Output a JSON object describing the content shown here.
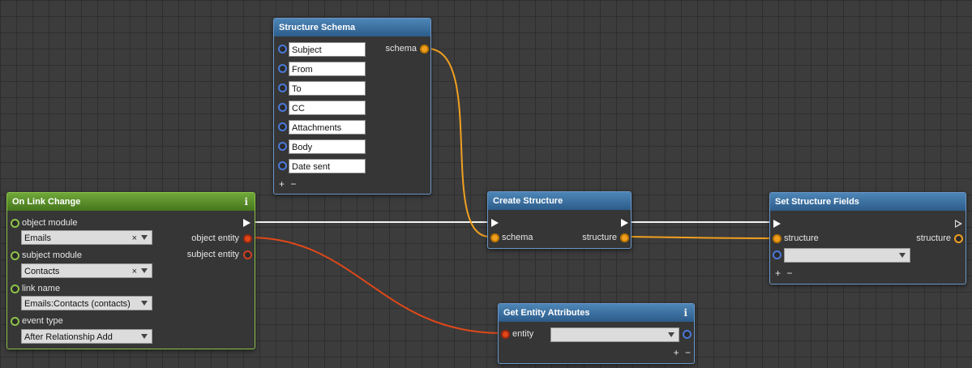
{
  "colors": {
    "background": "#3c3c3c",
    "grid": "#2f2f2f",
    "node_body": "#363636",
    "header_blue": "#3a6e9e",
    "header_green": "#5a8f2c",
    "pin_blue": "#4a78d8",
    "pin_orange": "#f0a020",
    "pin_red": "#e04818",
    "pin_green": "#8ec24a",
    "wire_orange": "#f0a020",
    "wire_red": "#e04818",
    "wire_exec": "#ffffff"
  },
  "structure_schema": {
    "title": "Structure Schema",
    "fields": [
      "Subject",
      "From",
      "To",
      "CC",
      "Attachments",
      "Body",
      "Date sent"
    ],
    "output_label": "schema",
    "add_remove": "+ −"
  },
  "on_link_change": {
    "title": "On Link Change",
    "info_icon": "i",
    "inputs": [
      {
        "label": "object module",
        "value": "Emails"
      },
      {
        "label": "subject module",
        "value": "Contacts"
      },
      {
        "label": "link name",
        "value": "Emails:Contacts (contacts)"
      },
      {
        "label": "event type",
        "value": "After Relationship Add"
      }
    ],
    "outputs": [
      "object entity",
      "subject entity"
    ],
    "clear_glyph": "×"
  },
  "create_structure": {
    "title": "Create Structure",
    "input_label": "schema",
    "output_label": "structure"
  },
  "set_structure_fields": {
    "title": "Set Structure Fields",
    "input_label": "structure",
    "output_label": "structure",
    "dropdown_value": "",
    "add_remove": "+ −"
  },
  "get_entity_attributes": {
    "title": "Get Entity Attributes",
    "info_icon": "i",
    "input_label": "entity",
    "dropdown_value": "",
    "add_remove": "+ −"
  }
}
